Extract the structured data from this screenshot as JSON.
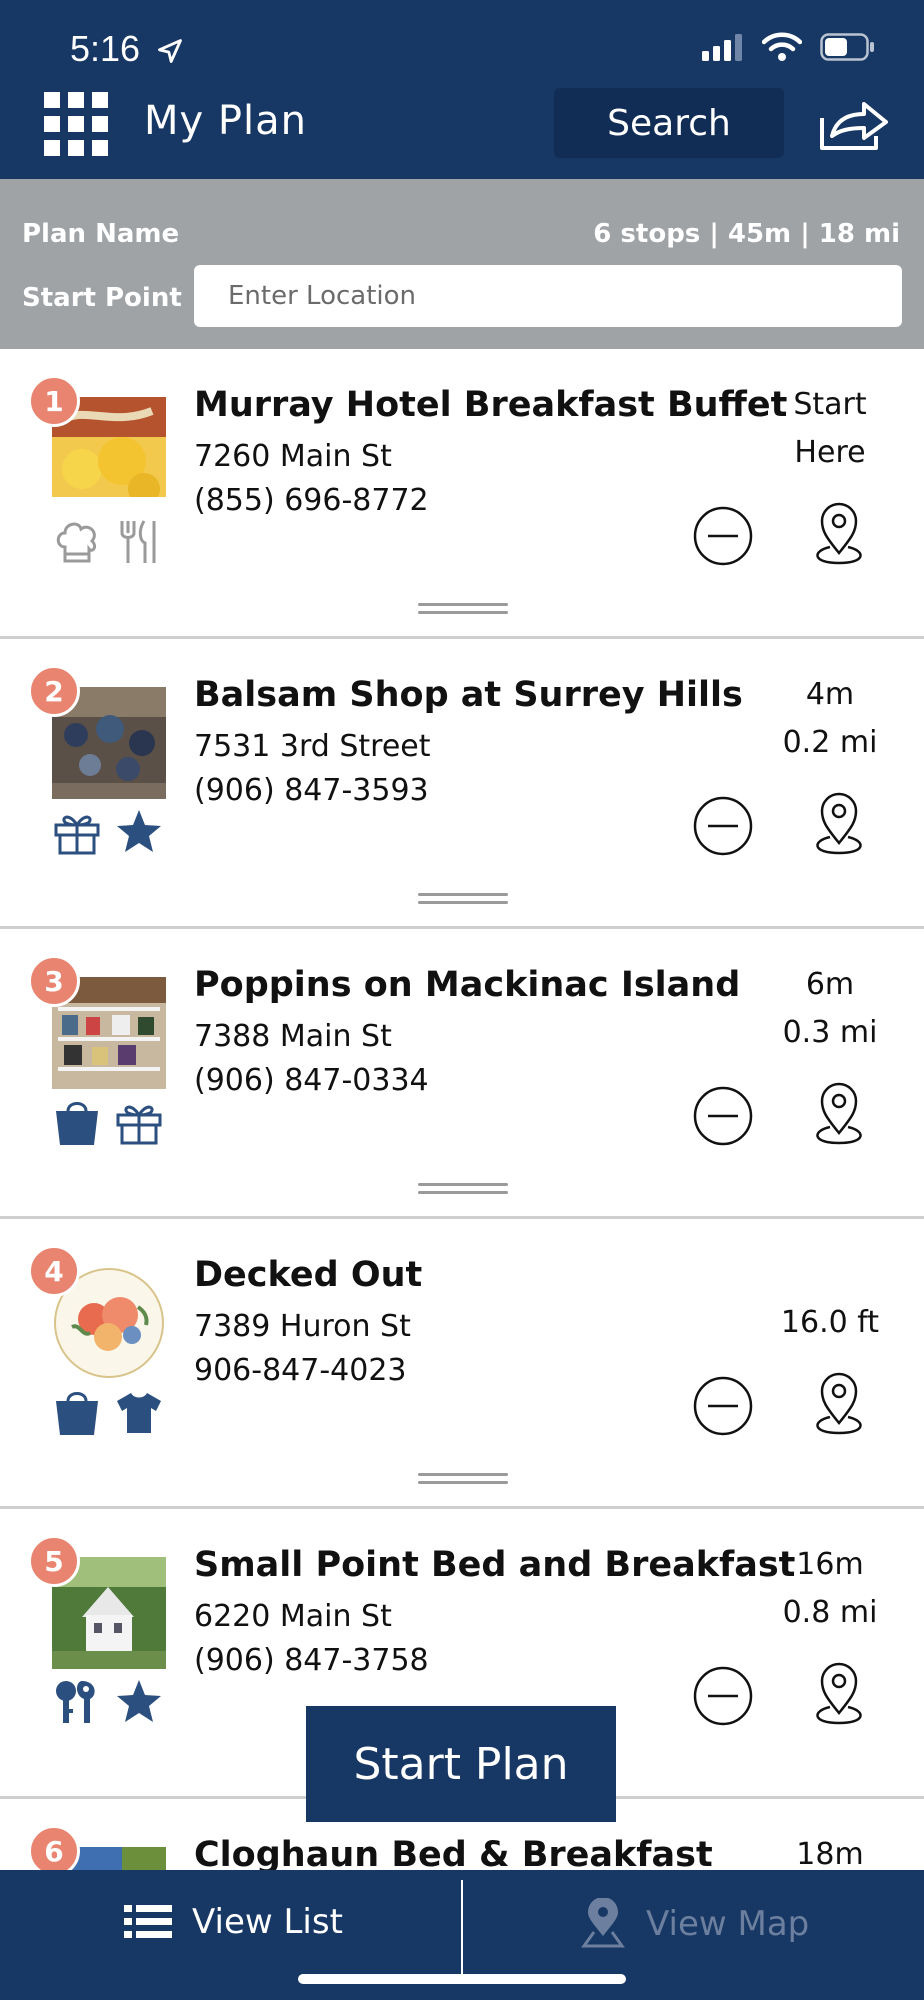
{
  "status_bar": {
    "time": "5:16"
  },
  "header": {
    "title": "My Plan",
    "search_label": "Search"
  },
  "plan": {
    "name_label": "Plan Name",
    "stats": "6 stops | 45m | 18 mi",
    "start_label": "Start Point",
    "start_placeholder": "Enter Location"
  },
  "stops": [
    {
      "number": "1",
      "name": "Murray Hotel Breakfast Buffet",
      "address": "7260 Main St",
      "phone": "(855) 696-8772",
      "dist_top": "Start",
      "dist_bottom": "Here",
      "icons": [
        "chef-hat-icon",
        "utensils-icon"
      ]
    },
    {
      "number": "2",
      "name": "Balsam Shop at Surrey Hills",
      "address": "7531 3rd Street",
      "phone": "(906) 847-3593",
      "dist_top": "4m",
      "dist_bottom": "0.2 mi",
      "icons": [
        "gift-icon",
        "star-icon"
      ]
    },
    {
      "number": "3",
      "name": "Poppins on Mackinac Island",
      "address": "7388 Main St",
      "phone": "(906) 847-0334",
      "dist_top": "6m",
      "dist_bottom": "0.3 mi",
      "icons": [
        "shopping-bag-icon",
        "gift-icon"
      ]
    },
    {
      "number": "4",
      "name": "Decked Out",
      "address": "7389 Huron St",
      "phone": "906-847-4023",
      "dist_top": "",
      "dist_bottom": "16.0 ft",
      "icons": [
        "shopping-bag-icon",
        "tshirt-icon"
      ]
    },
    {
      "number": "5",
      "name": "Small Point Bed and Breakfast",
      "address": "6220 Main St",
      "phone": "(906) 847-3758",
      "dist_top": "16m",
      "dist_bottom": "0.8 mi",
      "icons": [
        "keys-icon",
        "star-icon"
      ]
    },
    {
      "number": "6",
      "name": "Cloghaun Bed & Breakfast",
      "address": "",
      "phone": "",
      "dist_top": "18m",
      "dist_bottom": "",
      "icons": []
    }
  ],
  "start_plan_label": "Start Plan",
  "bottom_bar": {
    "view_list": "View List",
    "view_map": "View Map"
  },
  "colors": {
    "header_bg": "#173764",
    "plan_bar_bg": "#a0a3a6",
    "badge": "#e8846f",
    "icon_blue": "#2b4f7e"
  }
}
